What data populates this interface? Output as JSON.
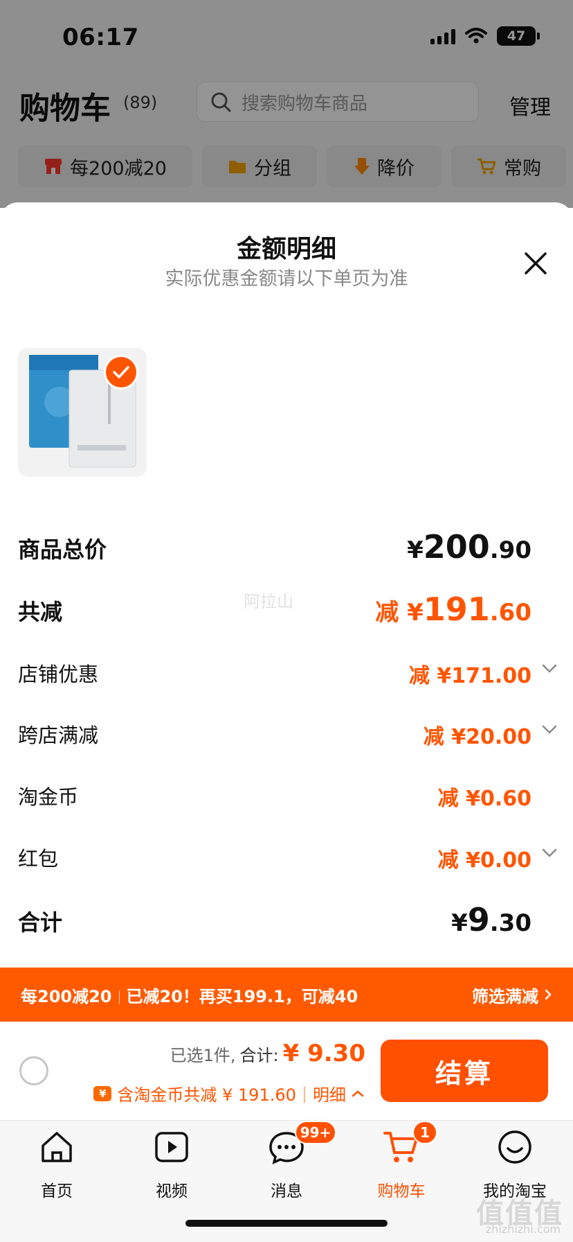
{
  "status_bar": {
    "time": "06:17",
    "battery": "47"
  },
  "header": {
    "title": "购物车",
    "count": "(89)",
    "search_placeholder": "搜索购物车商品",
    "manage": "管理"
  },
  "filters": [
    {
      "label": "每200减20",
      "icon": "shop-icon"
    },
    {
      "label": "分组",
      "icon": "folder-icon"
    },
    {
      "label": "降价",
      "icon": "price-down-icon"
    },
    {
      "label": "常购",
      "icon": "cart-plus-icon"
    }
  ],
  "sheet": {
    "title": "金额明细",
    "subtitle": "实际优惠金额请以下单页为准"
  },
  "rows": {
    "total_price": {
      "label": "商品总价",
      "symbol": "¥",
      "int": "200",
      "dec": ".90"
    },
    "total_discount": {
      "label": "共减",
      "prefix": "减 ¥",
      "int": "191",
      "dec": ".60"
    },
    "shop_discount": {
      "label": "店铺优惠",
      "value": "减 ¥171.00"
    },
    "cross_shop": {
      "label": "跨店满减",
      "value": "减 ¥20.00"
    },
    "taojin_coin": {
      "label": "淘金币",
      "value": "减 ¥0.60"
    },
    "red_packet": {
      "label": "红包",
      "value": "减 ¥0.00"
    },
    "sum": {
      "label": "合计",
      "symbol": "¥",
      "int": "9",
      "dec": ".30"
    }
  },
  "watermark": "阿拉山",
  "promo": {
    "rule": "每200减20",
    "status": "已减20！再买199.1，可减40",
    "filter": "筛选满减"
  },
  "checkout": {
    "selected": "已选1件,",
    "total_label": "合计:",
    "total_amount": "¥ 9.30",
    "coin_symbol": "¥",
    "discount_text": "含淘金币共减 ¥ 191.60",
    "detail": "明细",
    "button": "结算"
  },
  "tabbar": {
    "items": [
      {
        "label": "首页",
        "icon": "home-icon"
      },
      {
        "label": "视频",
        "icon": "video-icon"
      },
      {
        "label": "消息",
        "icon": "message-icon",
        "badge": "99+"
      },
      {
        "label": "购物车",
        "icon": "cart-icon",
        "badge": "1",
        "active": true
      },
      {
        "label": "我的淘宝",
        "icon": "profile-icon"
      }
    ]
  },
  "site_watermark": {
    "mark": "值值值",
    "url": "zhizhizhi.com"
  },
  "colors": {
    "accent": "#ff5000",
    "promo_bar": "#ff5a00"
  }
}
